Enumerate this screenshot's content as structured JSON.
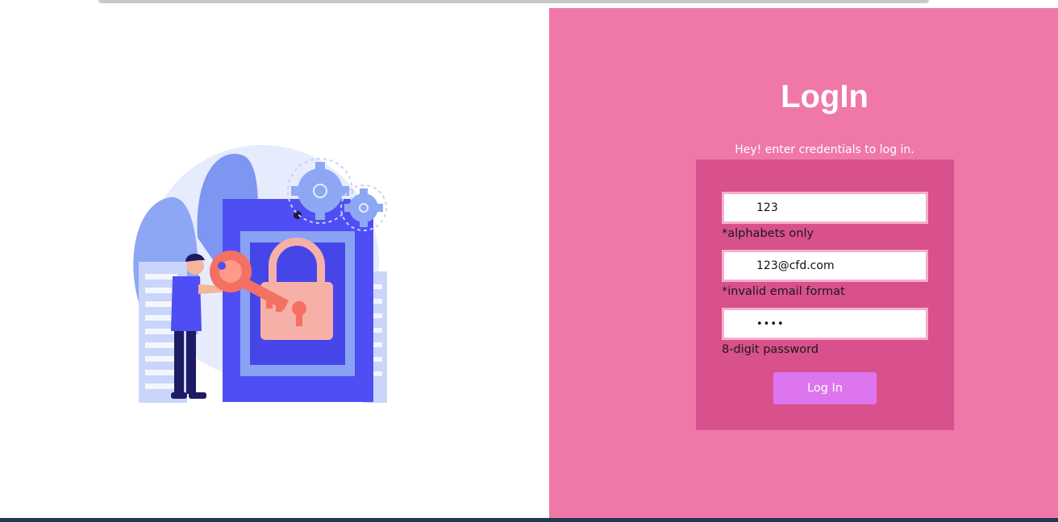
{
  "colors": {
    "right_panel_bg": "#ef78a9",
    "form_card_bg": "#d8508c",
    "input_border": "#f6aecd",
    "button_bg": "#dd76ee",
    "illustration_primary": "#4f4ef5",
    "illustration_secondary": "#8fa4f4",
    "key_color": "#f37163",
    "lock_color": "#f7b0a8"
  },
  "illustration": {
    "icons": [
      "gear-icon",
      "lock-icon",
      "key-icon",
      "person-figure"
    ]
  },
  "login": {
    "title": "LogIn",
    "subtitle": "Hey! enter credentials to log in.",
    "name_field": {
      "value": "123",
      "hint": "*alphabets only"
    },
    "email_field": {
      "value": "123@cfd.com",
      "hint": "*invalid email format"
    },
    "password_field": {
      "value": "••••",
      "hint": "8-digit password"
    },
    "submit_label": "Log In"
  }
}
